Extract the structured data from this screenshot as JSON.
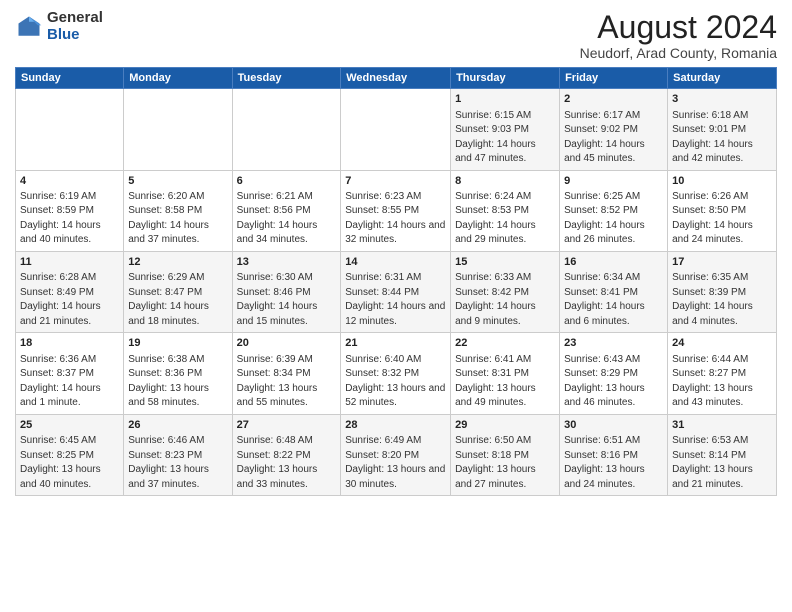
{
  "header": {
    "logo_general": "General",
    "logo_blue": "Blue",
    "main_title": "August 2024",
    "subtitle": "Neudorf, Arad County, Romania"
  },
  "weekdays": [
    "Sunday",
    "Monday",
    "Tuesday",
    "Wednesday",
    "Thursday",
    "Friday",
    "Saturday"
  ],
  "weeks": [
    [
      {
        "day": "",
        "info": ""
      },
      {
        "day": "",
        "info": ""
      },
      {
        "day": "",
        "info": ""
      },
      {
        "day": "",
        "info": ""
      },
      {
        "day": "1",
        "info": "Sunrise: 6:15 AM\nSunset: 9:03 PM\nDaylight: 14 hours and 47 minutes."
      },
      {
        "day": "2",
        "info": "Sunrise: 6:17 AM\nSunset: 9:02 PM\nDaylight: 14 hours and 45 minutes."
      },
      {
        "day": "3",
        "info": "Sunrise: 6:18 AM\nSunset: 9:01 PM\nDaylight: 14 hours and 42 minutes."
      }
    ],
    [
      {
        "day": "4",
        "info": "Sunrise: 6:19 AM\nSunset: 8:59 PM\nDaylight: 14 hours and 40 minutes."
      },
      {
        "day": "5",
        "info": "Sunrise: 6:20 AM\nSunset: 8:58 PM\nDaylight: 14 hours and 37 minutes."
      },
      {
        "day": "6",
        "info": "Sunrise: 6:21 AM\nSunset: 8:56 PM\nDaylight: 14 hours and 34 minutes."
      },
      {
        "day": "7",
        "info": "Sunrise: 6:23 AM\nSunset: 8:55 PM\nDaylight: 14 hours and 32 minutes."
      },
      {
        "day": "8",
        "info": "Sunrise: 6:24 AM\nSunset: 8:53 PM\nDaylight: 14 hours and 29 minutes."
      },
      {
        "day": "9",
        "info": "Sunrise: 6:25 AM\nSunset: 8:52 PM\nDaylight: 14 hours and 26 minutes."
      },
      {
        "day": "10",
        "info": "Sunrise: 6:26 AM\nSunset: 8:50 PM\nDaylight: 14 hours and 24 minutes."
      }
    ],
    [
      {
        "day": "11",
        "info": "Sunrise: 6:28 AM\nSunset: 8:49 PM\nDaylight: 14 hours and 21 minutes."
      },
      {
        "day": "12",
        "info": "Sunrise: 6:29 AM\nSunset: 8:47 PM\nDaylight: 14 hours and 18 minutes."
      },
      {
        "day": "13",
        "info": "Sunrise: 6:30 AM\nSunset: 8:46 PM\nDaylight: 14 hours and 15 minutes."
      },
      {
        "day": "14",
        "info": "Sunrise: 6:31 AM\nSunset: 8:44 PM\nDaylight: 14 hours and 12 minutes."
      },
      {
        "day": "15",
        "info": "Sunrise: 6:33 AM\nSunset: 8:42 PM\nDaylight: 14 hours and 9 minutes."
      },
      {
        "day": "16",
        "info": "Sunrise: 6:34 AM\nSunset: 8:41 PM\nDaylight: 14 hours and 6 minutes."
      },
      {
        "day": "17",
        "info": "Sunrise: 6:35 AM\nSunset: 8:39 PM\nDaylight: 14 hours and 4 minutes."
      }
    ],
    [
      {
        "day": "18",
        "info": "Sunrise: 6:36 AM\nSunset: 8:37 PM\nDaylight: 14 hours and 1 minute."
      },
      {
        "day": "19",
        "info": "Sunrise: 6:38 AM\nSunset: 8:36 PM\nDaylight: 13 hours and 58 minutes."
      },
      {
        "day": "20",
        "info": "Sunrise: 6:39 AM\nSunset: 8:34 PM\nDaylight: 13 hours and 55 minutes."
      },
      {
        "day": "21",
        "info": "Sunrise: 6:40 AM\nSunset: 8:32 PM\nDaylight: 13 hours and 52 minutes."
      },
      {
        "day": "22",
        "info": "Sunrise: 6:41 AM\nSunset: 8:31 PM\nDaylight: 13 hours and 49 minutes."
      },
      {
        "day": "23",
        "info": "Sunrise: 6:43 AM\nSunset: 8:29 PM\nDaylight: 13 hours and 46 minutes."
      },
      {
        "day": "24",
        "info": "Sunrise: 6:44 AM\nSunset: 8:27 PM\nDaylight: 13 hours and 43 minutes."
      }
    ],
    [
      {
        "day": "25",
        "info": "Sunrise: 6:45 AM\nSunset: 8:25 PM\nDaylight: 13 hours and 40 minutes."
      },
      {
        "day": "26",
        "info": "Sunrise: 6:46 AM\nSunset: 8:23 PM\nDaylight: 13 hours and 37 minutes."
      },
      {
        "day": "27",
        "info": "Sunrise: 6:48 AM\nSunset: 8:22 PM\nDaylight: 13 hours and 33 minutes."
      },
      {
        "day": "28",
        "info": "Sunrise: 6:49 AM\nSunset: 8:20 PM\nDaylight: 13 hours and 30 minutes."
      },
      {
        "day": "29",
        "info": "Sunrise: 6:50 AM\nSunset: 8:18 PM\nDaylight: 13 hours and 27 minutes."
      },
      {
        "day": "30",
        "info": "Sunrise: 6:51 AM\nSunset: 8:16 PM\nDaylight: 13 hours and 24 minutes."
      },
      {
        "day": "31",
        "info": "Sunrise: 6:53 AM\nSunset: 8:14 PM\nDaylight: 13 hours and 21 minutes."
      }
    ]
  ]
}
